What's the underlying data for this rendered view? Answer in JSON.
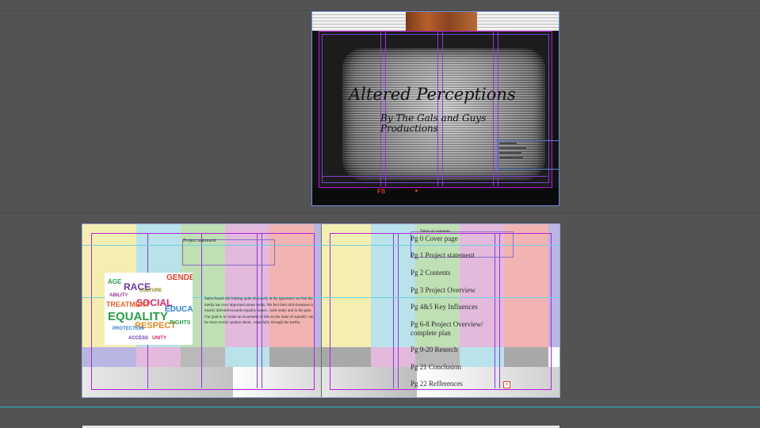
{
  "cover": {
    "title": "Altered Perceptions",
    "subtitle": "By The Gals and Guys Productions",
    "tv_brand_mark": "FS"
  },
  "spread": {
    "project_statement": {
      "heading": "Project statement",
      "body": "Satire based skit hinting quite obviously at the ignorance we feel the media has over important issues today. We feel their obliviousness is mostly directed towards equality issues , both today and in the past. Our goal is to create an awareness of this so the issue of equality can be more evenly spoken about , especially through the media."
    },
    "wordcloud": {
      "words": [
        "EQUALITY",
        "SOCIAL",
        "RESPECT",
        "RACE",
        "TREATMENT",
        "GENDER",
        "EDUCAT",
        "PROTECTION",
        "CULTURE",
        "RIGHTS",
        "ABILITY",
        "AGE",
        "UNITY",
        "ACCESS"
      ]
    },
    "contents": {
      "heading": "Table of contents",
      "items": [
        "Pg 0 Cover page",
        "Pg 1 Project statement",
        "Pg 2 Contents",
        "Pg 3  Project Overview",
        "Pg 4&5 Key Influences",
        "Pg 6-8 Project Overview/ complete plan",
        "Pg 9-20 Reserch",
        "Pg 21 Conclusion",
        "Pg 22 Refferences"
      ]
    },
    "colorbar_colors": [
      "#f4efb0",
      "#b9e2ea",
      "#bfe0b4",
      "#e3b9dc",
      "#f2b3b3",
      "#b9b6e3"
    ],
    "accent_guide": "#8a3bdc",
    "overset_marker": "+"
  }
}
